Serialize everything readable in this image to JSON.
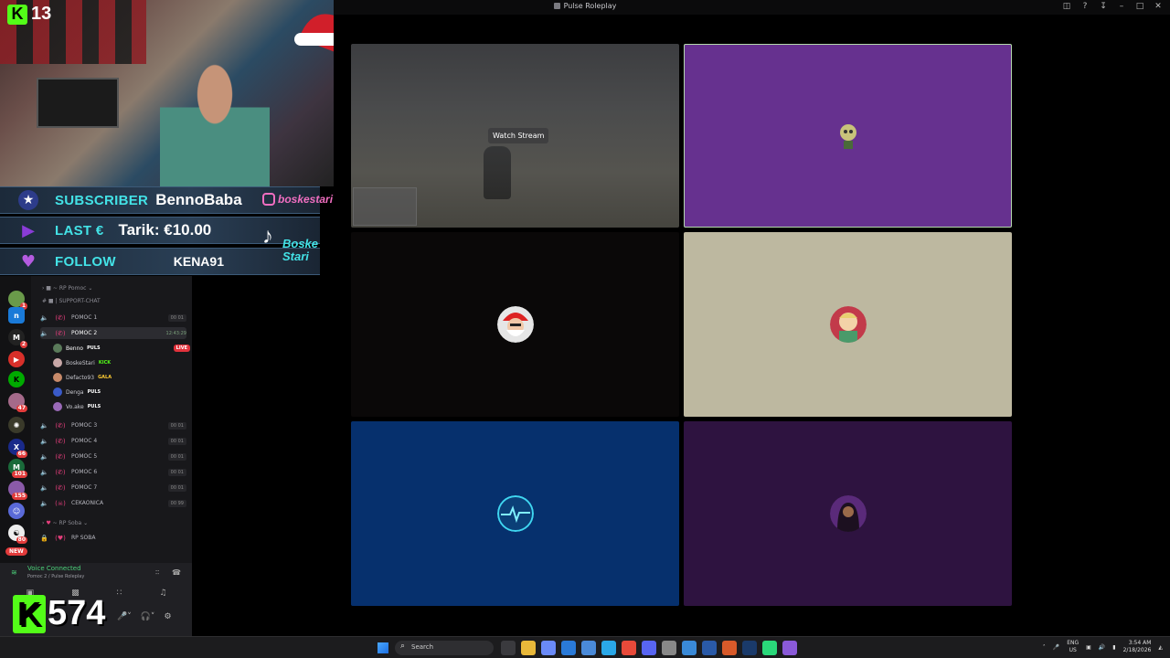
{
  "window": {
    "title": "Pulse Roleplay"
  },
  "webcam": {
    "kick_viewers": "13"
  },
  "alerts": {
    "subscriber_label": "SUBSCRIBER",
    "subscriber_name": "BennoBaba",
    "last_label": "LAST €",
    "last_value": "Tarik: €10.00",
    "follow_label": "FOLLOW",
    "follow_name": "KENA91",
    "instagram": "boskestari",
    "tiktok_line1": "Boske",
    "tiktok_line2": "Stari"
  },
  "stream": {
    "watch_label": "Watch Stream"
  },
  "channels": {
    "category1": "RP Pomoc",
    "text_channel": "SUPPORT-CHAT",
    "items": [
      {
        "name": "POMOC 1",
        "counts": "00 01"
      },
      {
        "name": "POMOC 2",
        "timer": "12:43:29"
      },
      {
        "name": "POMOC 3",
        "counts": "00 01"
      },
      {
        "name": "POMOC 4",
        "counts": "00 01"
      },
      {
        "name": "POMOC 5",
        "counts": "00 01"
      },
      {
        "name": "POMOC 6",
        "counts": "00 01"
      },
      {
        "name": "POMOC 7",
        "counts": "00 01"
      },
      {
        "name": "CEKAONICA",
        "counts": "00 99"
      }
    ],
    "members": [
      {
        "name": "Benno",
        "tag": "PULS",
        "live": "LIVE"
      },
      {
        "name": "BoskeStari",
        "tag": "KICK"
      },
      {
        "name": "Defacto93",
        "tag": "GALA"
      },
      {
        "name": "Denga",
        "tag": "PULS"
      },
      {
        "name": "Vo.ake",
        "tag": "PULS"
      }
    ],
    "category2": "RP Soba",
    "locked_channel": "RP SOBA"
  },
  "voice": {
    "status": "Voice Connected",
    "location": "Pomoc 2 / Pulse Roleplay"
  },
  "overlay": {
    "kick_count": "574",
    "handle": "boskestari"
  },
  "rail": {
    "new_label": "NEW"
  },
  "taskbar": {
    "search_placeholder": "Search",
    "lang_top": "ENG",
    "lang_bottom": "US",
    "time": "3:54 AM",
    "date": "2/18/2026"
  },
  "colors": {
    "accent_cyan": "#43e2e6",
    "accent_pink": "#f06ec0",
    "kick_green": "#53fc18",
    "discord_green": "#4bd17a"
  }
}
